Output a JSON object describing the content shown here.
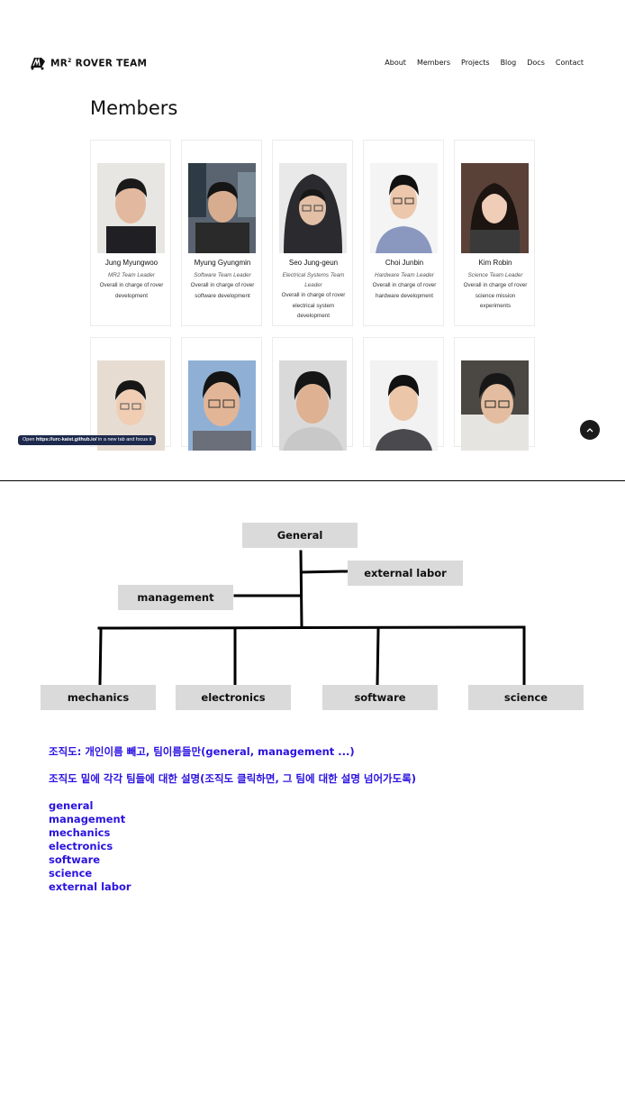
{
  "site": {
    "logo_prefix": "MR",
    "logo_sup": "2",
    "logo_suffix": " ROVER TEAM",
    "nav": [
      "About",
      "Members",
      "Projects",
      "Blog",
      "Docs",
      "Contact"
    ],
    "page_title": "Members"
  },
  "members_row1": [
    {
      "name": "Jung Myungwoo",
      "role": "MR2 Team Leader",
      "desc": "Overall in charge of rover development"
    },
    {
      "name": "Myung Gyungmin",
      "role": "Software Team Leader",
      "desc": "Overall in charge of rover software development"
    },
    {
      "name": "Seo Jung-geun",
      "role": "Electrical Systems Team Leader",
      "desc": "Overall in charge of rover electrical system development"
    },
    {
      "name": "Choi Junbin",
      "role": "Hardware Team Leader",
      "desc": "Overall in charge of rover hardware development"
    },
    {
      "name": "Kim Robin",
      "role": "Science Team Leader",
      "desc": "Overall in charge of rover science mission experiments"
    }
  ],
  "tooltip": {
    "prefix": "Open ",
    "url": "https://urc-kaist.github.io/",
    "suffix": " in a new tab and focus it"
  },
  "org": {
    "general": "General",
    "external": "external labor",
    "management": "management",
    "mechanics": "mechanics",
    "electronics": "electronics",
    "software": "software",
    "science": "science"
  },
  "notes": [
    "조직도: 개인이름 빼고, 팀이름들만(general, management ...)",
    "조직도 밑에 각각 팀들에 대한 설명(조직도 클릭하면, 그 팀에 대한 설명 넘어가도록)"
  ],
  "teams": [
    "general",
    "management",
    "mechanics",
    "electronics",
    "software",
    "science",
    "external labor"
  ],
  "colors": {
    "note_text": "#2b13e0",
    "org_box": "#dadada",
    "tooltip_bg": "#1d2a4d"
  }
}
